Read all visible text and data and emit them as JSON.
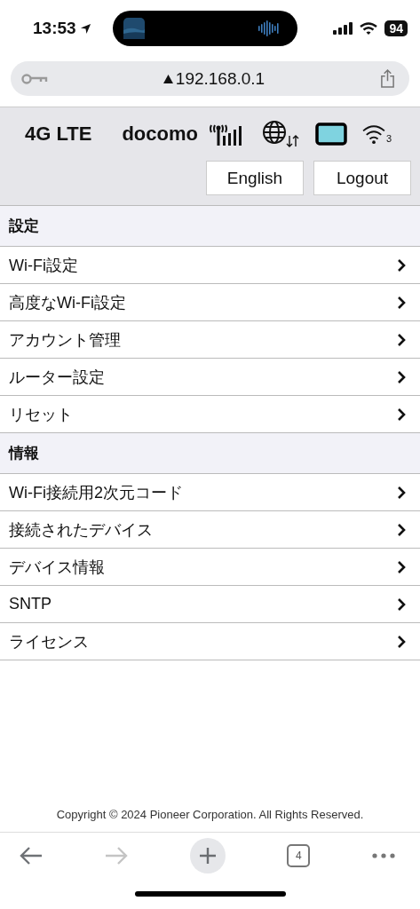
{
  "status_bar": {
    "time": "13:53",
    "battery": "94"
  },
  "address_bar": {
    "url": "192.168.0.1"
  },
  "router_status": {
    "network": "4G LTE",
    "carrier": "docomo",
    "wifi_clients": "3"
  },
  "header_buttons": [
    "English",
    "Logout"
  ],
  "sections": [
    {
      "title": "設定",
      "items": [
        "Wi-Fi設定",
        "高度なWi-Fi設定",
        "アカウント管理",
        "ルーター設定",
        "リセット"
      ]
    },
    {
      "title": "情報",
      "items": [
        "Wi-Fi接続用2次元コード",
        "接続されたデバイス",
        "デバイス情報",
        "SNTP",
        "ライセンス"
      ]
    }
  ],
  "footer": "Copyright © 2024 Pioneer Corporation. All Rights Reserved.",
  "toolbar": {
    "back_disabled": false,
    "forward_disabled": true,
    "tab_count": "4"
  }
}
